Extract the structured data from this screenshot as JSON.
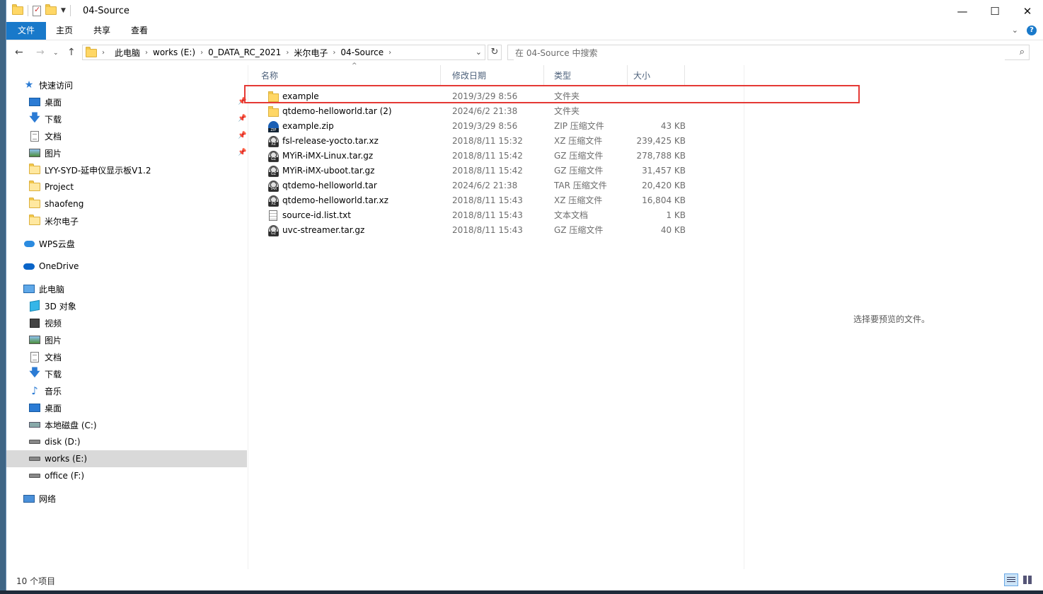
{
  "window": {
    "title": "04-Source",
    "controls": {
      "minimize": "—",
      "maximize": "☐",
      "close": "✕"
    }
  },
  "ribbon": {
    "tabs": [
      "文件",
      "主页",
      "共享",
      "查看"
    ],
    "collapse": "⌄",
    "help": "?"
  },
  "address": {
    "crumbs": [
      "此电脑",
      "works (E:)",
      "0_DATA_RC_2021",
      "米尔电子",
      "04-Source"
    ]
  },
  "search": {
    "placeholder": "在 04-Source 中搜索"
  },
  "nav": {
    "quick_access": "快速访问",
    "items": [
      {
        "label": "桌面"
      },
      {
        "label": "下载"
      },
      {
        "label": "文档"
      },
      {
        "label": "图片"
      },
      {
        "label": "LYY-SYD-延申仪显示板V1.2"
      },
      {
        "label": "Project"
      },
      {
        "label": "shaofeng"
      },
      {
        "label": "米尔电子"
      }
    ],
    "wps": "WPS云盘",
    "onedrive": "OneDrive",
    "this_pc": "此电脑",
    "pc_items": [
      {
        "label": "3D 对象"
      },
      {
        "label": "视频"
      },
      {
        "label": "图片"
      },
      {
        "label": "文档"
      },
      {
        "label": "下载"
      },
      {
        "label": "音乐"
      },
      {
        "label": "桌面"
      },
      {
        "label": "本地磁盘 (C:)"
      },
      {
        "label": "disk (D:)"
      },
      {
        "label": "works (E:)"
      },
      {
        "label": "office (F:)"
      }
    ],
    "network": "网络"
  },
  "columns": {
    "name": "名称",
    "date": "修改日期",
    "type": "类型",
    "size": "大小"
  },
  "files": [
    {
      "name": "example",
      "date": "2019/3/29 8:56",
      "type": "文件夹",
      "size": "",
      "icon": "folder"
    },
    {
      "name": "qtdemo-helloworld.tar (2)",
      "date": "2024/6/2 21:38",
      "type": "文件夹",
      "size": "",
      "icon": "folder"
    },
    {
      "name": "example.zip",
      "date": "2019/3/29 8:56",
      "type": "ZIP 压缩文件",
      "size": "43 KB",
      "icon": "zip"
    },
    {
      "name": "fsl-release-yocto.tar.xz",
      "date": "2018/8/11 15:32",
      "type": "XZ 压缩文件",
      "size": "239,425 KB",
      "icon": "xz"
    },
    {
      "name": "MYiR-iMX-Linux.tar.gz",
      "date": "2018/8/11 15:42",
      "type": "GZ 压缩文件",
      "size": "278,788 KB",
      "icon": "gz"
    },
    {
      "name": "MYiR-iMX-uboot.tar.gz",
      "date": "2018/8/11 15:42",
      "type": "GZ 压缩文件",
      "size": "31,457 KB",
      "icon": "gz"
    },
    {
      "name": "qtdemo-helloworld.tar",
      "date": "2024/6/2 21:38",
      "type": "TAR 压缩文件",
      "size": "20,420 KB",
      "icon": "tar"
    },
    {
      "name": "qtdemo-helloworld.tar.xz",
      "date": "2018/8/11 15:43",
      "type": "XZ 压缩文件",
      "size": "16,804 KB",
      "icon": "xz"
    },
    {
      "name": "source-id.list.txt",
      "date": "2018/8/11 15:43",
      "type": "文本文档",
      "size": "1 KB",
      "icon": "txt"
    },
    {
      "name": "uvc-streamer.tar.gz",
      "date": "2018/8/11 15:43",
      "type": "GZ 压缩文件",
      "size": "40 KB",
      "icon": "gz"
    }
  ],
  "preview": {
    "message": "选择要预览的文件。"
  },
  "status": {
    "count": "10 个项目"
  },
  "colors": {
    "accent": "#1979ca",
    "highlight": "#e53935",
    "selected_nav": "#d9d9d9"
  }
}
